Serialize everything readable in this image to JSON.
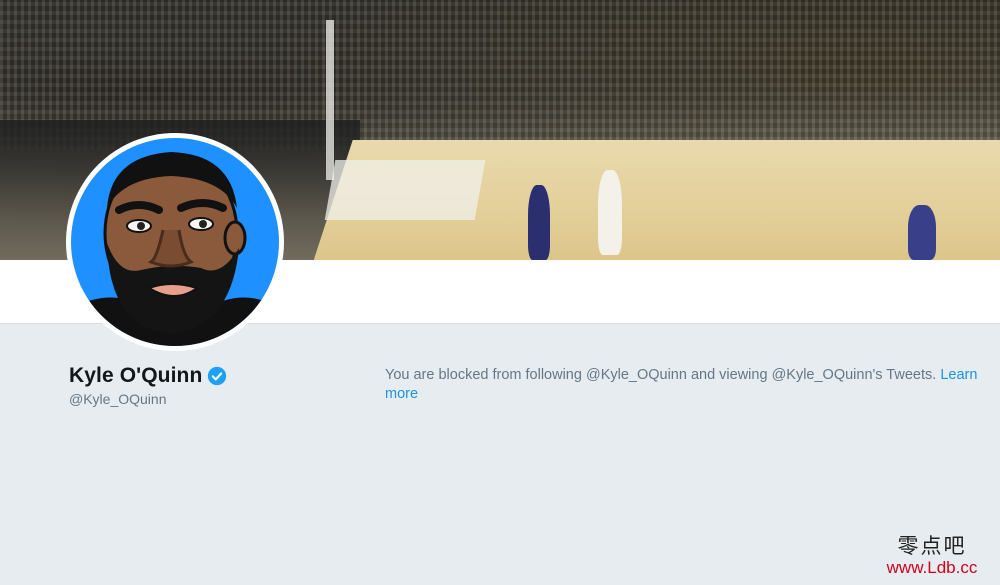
{
  "profile": {
    "display_name": "Kyle O'Quinn",
    "handle": "@Kyle_OQuinn",
    "verified_icon": "verified-badge-icon"
  },
  "blocked_notice": {
    "text": "You are blocked from following @Kyle_OQuinn and viewing @Kyle_OQuinn's Tweets. ",
    "link_label": "Learn more"
  },
  "watermark": {
    "chinese": "零点吧",
    "url": "www.Ldb.cc"
  },
  "colors": {
    "link": "#1b95e0",
    "verified": "#1da1f2",
    "background": "#e6ecf0",
    "avatar_bg": "#1e90ff"
  }
}
